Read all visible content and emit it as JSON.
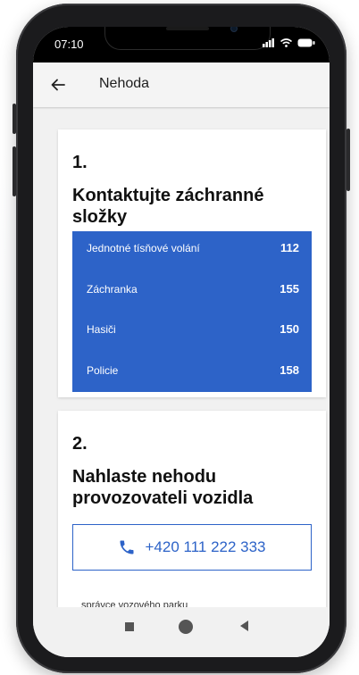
{
  "status_bar": {
    "time": "07:10"
  },
  "app_bar": {
    "title": "Nehoda"
  },
  "step1": {
    "number": "1.",
    "title": "Kontaktujte záchranné složky",
    "contacts": [
      {
        "label": "Jednotné tísňové volání",
        "number": "112"
      },
      {
        "label": "Záchranka",
        "number": "155"
      },
      {
        "label": "Hasiči",
        "number": "150"
      },
      {
        "label": "Policie",
        "number": "158"
      }
    ]
  },
  "step2": {
    "number": "2.",
    "title": "Nahlaste nehodu provozovateli vozidla",
    "phone": "+420 111 222 333",
    "role": "správce vozového parku"
  },
  "colors": {
    "accent": "#2d63c8",
    "background": "#f1f1f1"
  },
  "icons": {
    "back": "arrow-left-icon",
    "call": "phone-icon"
  }
}
